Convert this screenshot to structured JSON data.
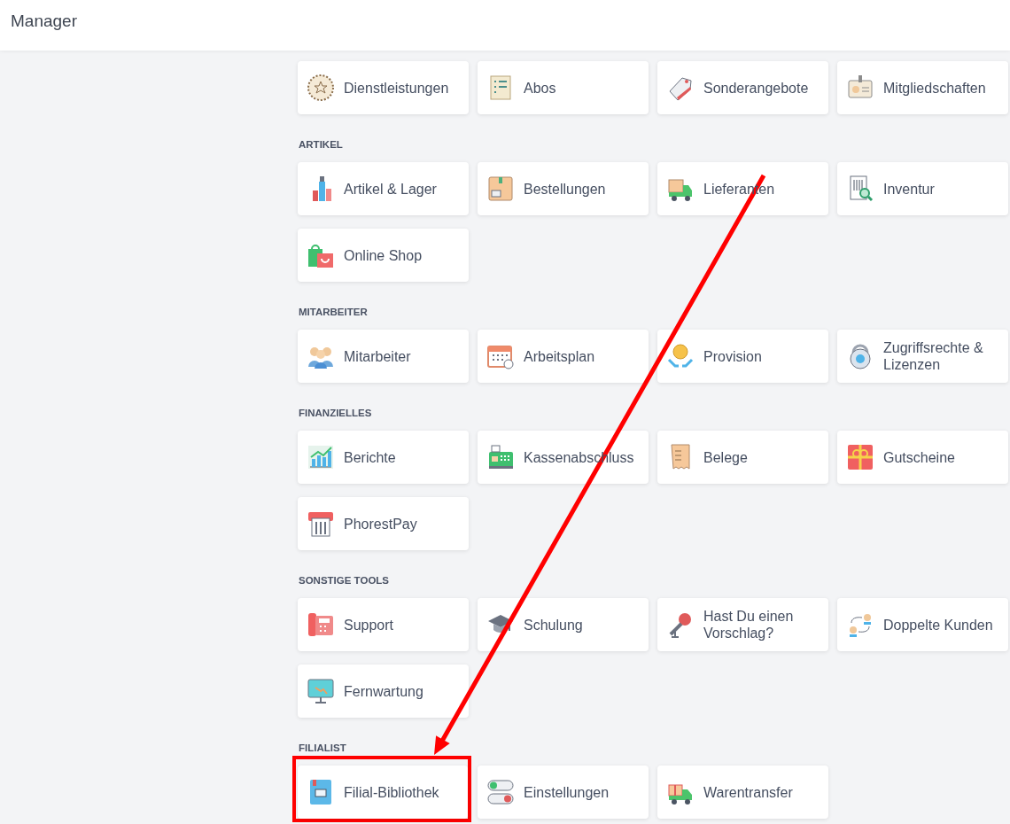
{
  "header": {
    "title": "Manager"
  },
  "annotation_arrow": true,
  "sections": [
    {
      "tiles": [
        {
          "label": "Dienstleistungen",
          "highlighted": false
        },
        {
          "label": "Abos",
          "highlighted": false
        },
        {
          "label": "Sonderangebote",
          "highlighted": false
        },
        {
          "label": "Mitgliedschaften",
          "highlighted": false
        }
      ]
    },
    {
      "label": "ARTIKEL",
      "tiles": [
        {
          "label": "Artikel & Lager",
          "highlighted": false
        },
        {
          "label": "Bestellungen",
          "highlighted": false
        },
        {
          "label": "Lieferanten",
          "highlighted": false
        },
        {
          "label": "Inventur",
          "highlighted": false
        },
        {
          "label": "Online Shop",
          "highlighted": false
        }
      ]
    },
    {
      "label": "MITARBEITER",
      "tiles": [
        {
          "label": "Mitarbeiter",
          "highlighted": false
        },
        {
          "label": "Arbeitsplan",
          "highlighted": false
        },
        {
          "label": "Provision",
          "highlighted": false
        },
        {
          "label": "Zugriffsrechte & Lizenzen",
          "highlighted": false
        }
      ]
    },
    {
      "label": "FINANZIELLES",
      "tiles": [
        {
          "label": "Berichte",
          "highlighted": false
        },
        {
          "label": "Kassenabschluss",
          "highlighted": false
        },
        {
          "label": "Belege",
          "highlighted": false
        },
        {
          "label": "Gutscheine",
          "highlighted": false
        },
        {
          "label": "PhorestPay",
          "highlighted": false
        }
      ]
    },
    {
      "label": "SONSTIGE TOOLS",
      "tiles": [
        {
          "label": "Support",
          "highlighted": false
        },
        {
          "label": "Schulung",
          "highlighted": false
        },
        {
          "label": "Hast Du einen Vorschlag?",
          "highlighted": false
        },
        {
          "label": "Doppelte Kunden",
          "highlighted": false
        },
        {
          "label": "Fernwartung",
          "highlighted": false
        }
      ]
    },
    {
      "label": "FILIALIST",
      "tiles": [
        {
          "label": "Filial-Bibliothek",
          "highlighted": true
        },
        {
          "label": "Einstellungen",
          "highlighted": false
        },
        {
          "label": "Warentransfer",
          "highlighted": false
        }
      ]
    }
  ]
}
